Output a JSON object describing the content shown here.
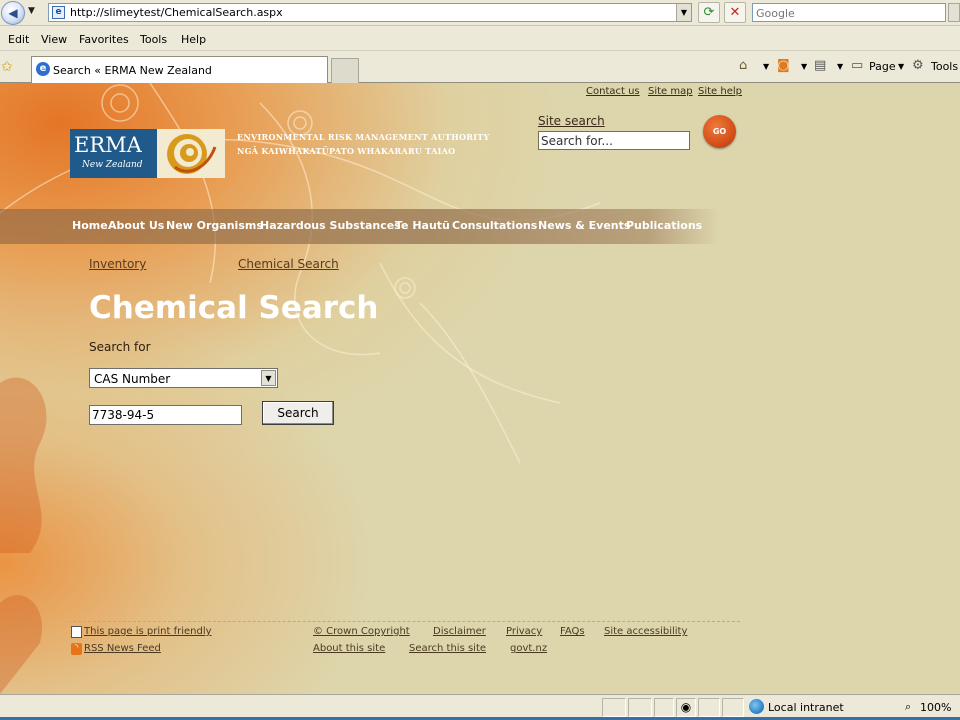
{
  "browser": {
    "url": "http://slimeytest/ChemicalSearch.aspx",
    "search_placeholder": "Google",
    "menu": [
      "Edit",
      "View",
      "Favorites",
      "Tools",
      "Help"
    ],
    "tab_title": "Search « ERMA New Zealand",
    "commands": {
      "page": "Page",
      "tools": "Tools"
    }
  },
  "site": {
    "top_links": [
      "Contact us",
      "Site map",
      "Site help"
    ],
    "logo": {
      "word": "ERMA",
      "sub": "New Zealand"
    },
    "org_name_line1": "ENVIRONMENTAL RISK MANAGEMENT AUTHORITY",
    "org_name_line2": "NGĀ KAIWHAKATŪPATO WHAKARARU TAIAO",
    "site_search_label": "Site search",
    "site_search_placeholder": "Search for...",
    "go_label": "GO",
    "nav": [
      "Home",
      "About Us",
      "New Organisms",
      "Hazardous Substances",
      "Te Hautū",
      "Consultations",
      "News & Events",
      "Publications"
    ]
  },
  "content": {
    "breadcrumb": [
      "Inventory",
      "Chemical Search"
    ],
    "title": "Chemical Search",
    "search_for_label": "Search for",
    "search_type_selected": "CAS Number",
    "search_value": "7738-94-5",
    "search_button": "Search"
  },
  "footer": {
    "print_friendly": "This page is print friendly",
    "rss": "RSS News Feed",
    "links_row1": [
      "© Crown Copyright",
      "Disclaimer",
      "Privacy",
      "FAQs",
      "Site accessibility"
    ],
    "links_row2": [
      "About this site",
      "Search this site",
      "govt.nz"
    ]
  },
  "status": {
    "zone": "Local intranet",
    "zoom": "100%"
  }
}
